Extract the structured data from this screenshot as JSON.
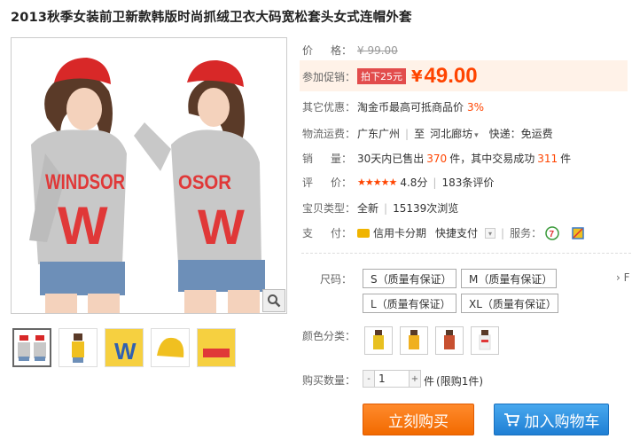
{
  "product": {
    "title": "2013秋季女装前卫新款韩版时尚抓绒卫衣大码宽松套头女式连帽外套",
    "hoodie_text": "WINDSOR",
    "hoodie_letter": "W"
  },
  "price": {
    "label_a": "价",
    "label_b": "格：",
    "original": "¥ 99.00"
  },
  "promo": {
    "label": "参加促销：",
    "tag": "拍下25元",
    "yen": "¥",
    "amount": "49.00"
  },
  "discount": {
    "label": "其它优惠：",
    "text": "淘金币最高可抵商品价",
    "percent": "3%"
  },
  "shipping": {
    "label": "物流运费：",
    "from": "广东广州",
    "to_label": "至",
    "to": "河北廊坊",
    "express": "快递：免运费"
  },
  "sales": {
    "label_a": "销",
    "label_b": "量：",
    "prefix": "30天内已售出",
    "sold": "370",
    "mid": "件，其中交易成功",
    "success": "311",
    "suffix": "件"
  },
  "rating": {
    "label_a": "评",
    "label_b": "价：",
    "stars": "★★★★★",
    "score": "4.8分",
    "reviews": "183条评价"
  },
  "condition": {
    "label": "宝贝类型：",
    "value": "全新",
    "views": "15139次浏览"
  },
  "payment": {
    "label_a": "支",
    "label_b": "付：",
    "credit": "信用卡分期",
    "quick": "快捷支付",
    "service_label": "服务："
  },
  "sizes": {
    "label": "尺码：",
    "options": [
      "S（质量有保证）",
      "M（质量有保证）",
      "L（质量有保证）",
      "XL（质量有保证）"
    ],
    "more": "› F"
  },
  "colors": {
    "label": "颜色分类：",
    "swatches": [
      "#e8c020",
      "#f0b020",
      "#c85030",
      "#f5f5f5"
    ]
  },
  "quantity": {
    "label": "购买数量：",
    "value": "1",
    "unit": "件",
    "limit": "(限购1件)",
    "minus": "-",
    "plus": "+"
  },
  "actions": {
    "buy_now": "立刻购买",
    "add_cart": "加入购物车"
  },
  "thumbnails": [
    "gray",
    "yellow",
    "yellow",
    "yellow",
    "yellow"
  ],
  "colors_theme": {
    "accent": "#ff4400",
    "buy": "#f26a00",
    "cart": "#1f7fd4"
  }
}
